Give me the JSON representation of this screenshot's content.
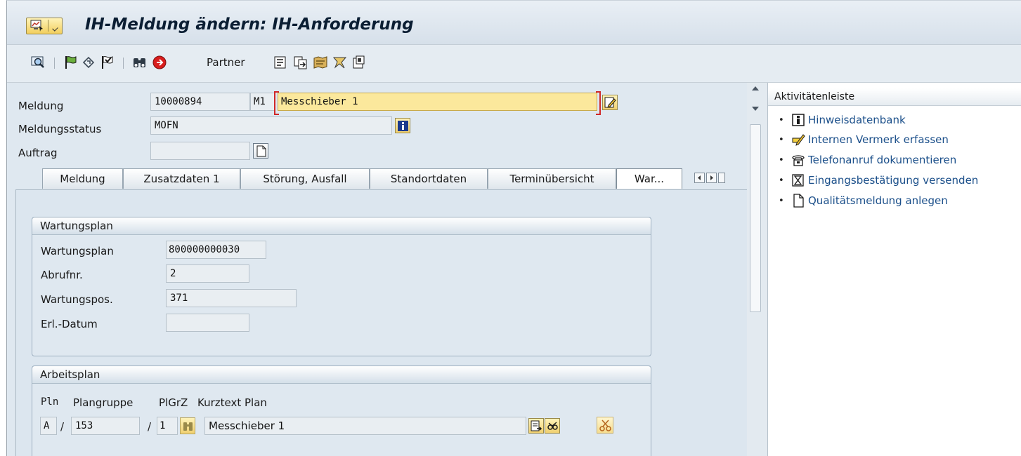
{
  "window": {
    "title": "IH-Meldung ändern: IH-Anforderung"
  },
  "toolbar": {
    "partner_label": "Partner"
  },
  "header": {
    "meldung_label": "Meldung",
    "meldung_value": "10000894",
    "meldung_type": "M1",
    "meldung_text": "Messchieber 1",
    "status_label": "Meldungsstatus",
    "status_value": "MOFN",
    "auftrag_label": "Auftrag",
    "auftrag_value": ""
  },
  "tabs": [
    {
      "label": "Meldung"
    },
    {
      "label": "Zusatzdaten 1"
    },
    {
      "label": "Störung, Ausfall"
    },
    {
      "label": "Standortdaten"
    },
    {
      "label": "Terminübersicht"
    },
    {
      "label": "War..."
    }
  ],
  "wartungsplan_group": {
    "title": "Wartungsplan",
    "fields": [
      {
        "label": "Wartungsplan",
        "value": "800000000030"
      },
      {
        "label": "Abrufnr.",
        "value": "2"
      },
      {
        "label": "Wartungspos.",
        "value": "371"
      },
      {
        "label": "Erl.-Datum",
        "value": ""
      }
    ]
  },
  "arbeitsplan_group": {
    "title": "Arbeitsplan",
    "col_pln": "Pln",
    "col_plangruppe": "Plangruppe",
    "col_plgrz": "PlGrZ",
    "col_kurztext": "Kurztext Plan",
    "pln_value": "A",
    "sep1": "/",
    "plangruppe_value": "153",
    "sep2": "/",
    "plgrz_value": "1",
    "kurztext_value": "Messchieber 1"
  },
  "activity_bar": {
    "title": "Aktivitätenleiste",
    "items": [
      {
        "label": "Hinweisdatenbank",
        "icon": "info-book-icon"
      },
      {
        "label": "Internen Vermerk erfassen",
        "icon": "pencil-note-icon"
      },
      {
        "label": "Telefonanruf dokumentieren",
        "icon": "telephone-icon"
      },
      {
        "label": "Eingangsbestätigung versenden",
        "icon": "hourglass-doc-icon"
      },
      {
        "label": "Qualitätsmeldung anlegen",
        "icon": "blank-document-icon"
      }
    ]
  },
  "colors": {
    "required_border": "#d02828",
    "link_text": "#1b4f8a",
    "focus_field": "#fbe89c",
    "panel_bg": "#dfe8f0"
  }
}
